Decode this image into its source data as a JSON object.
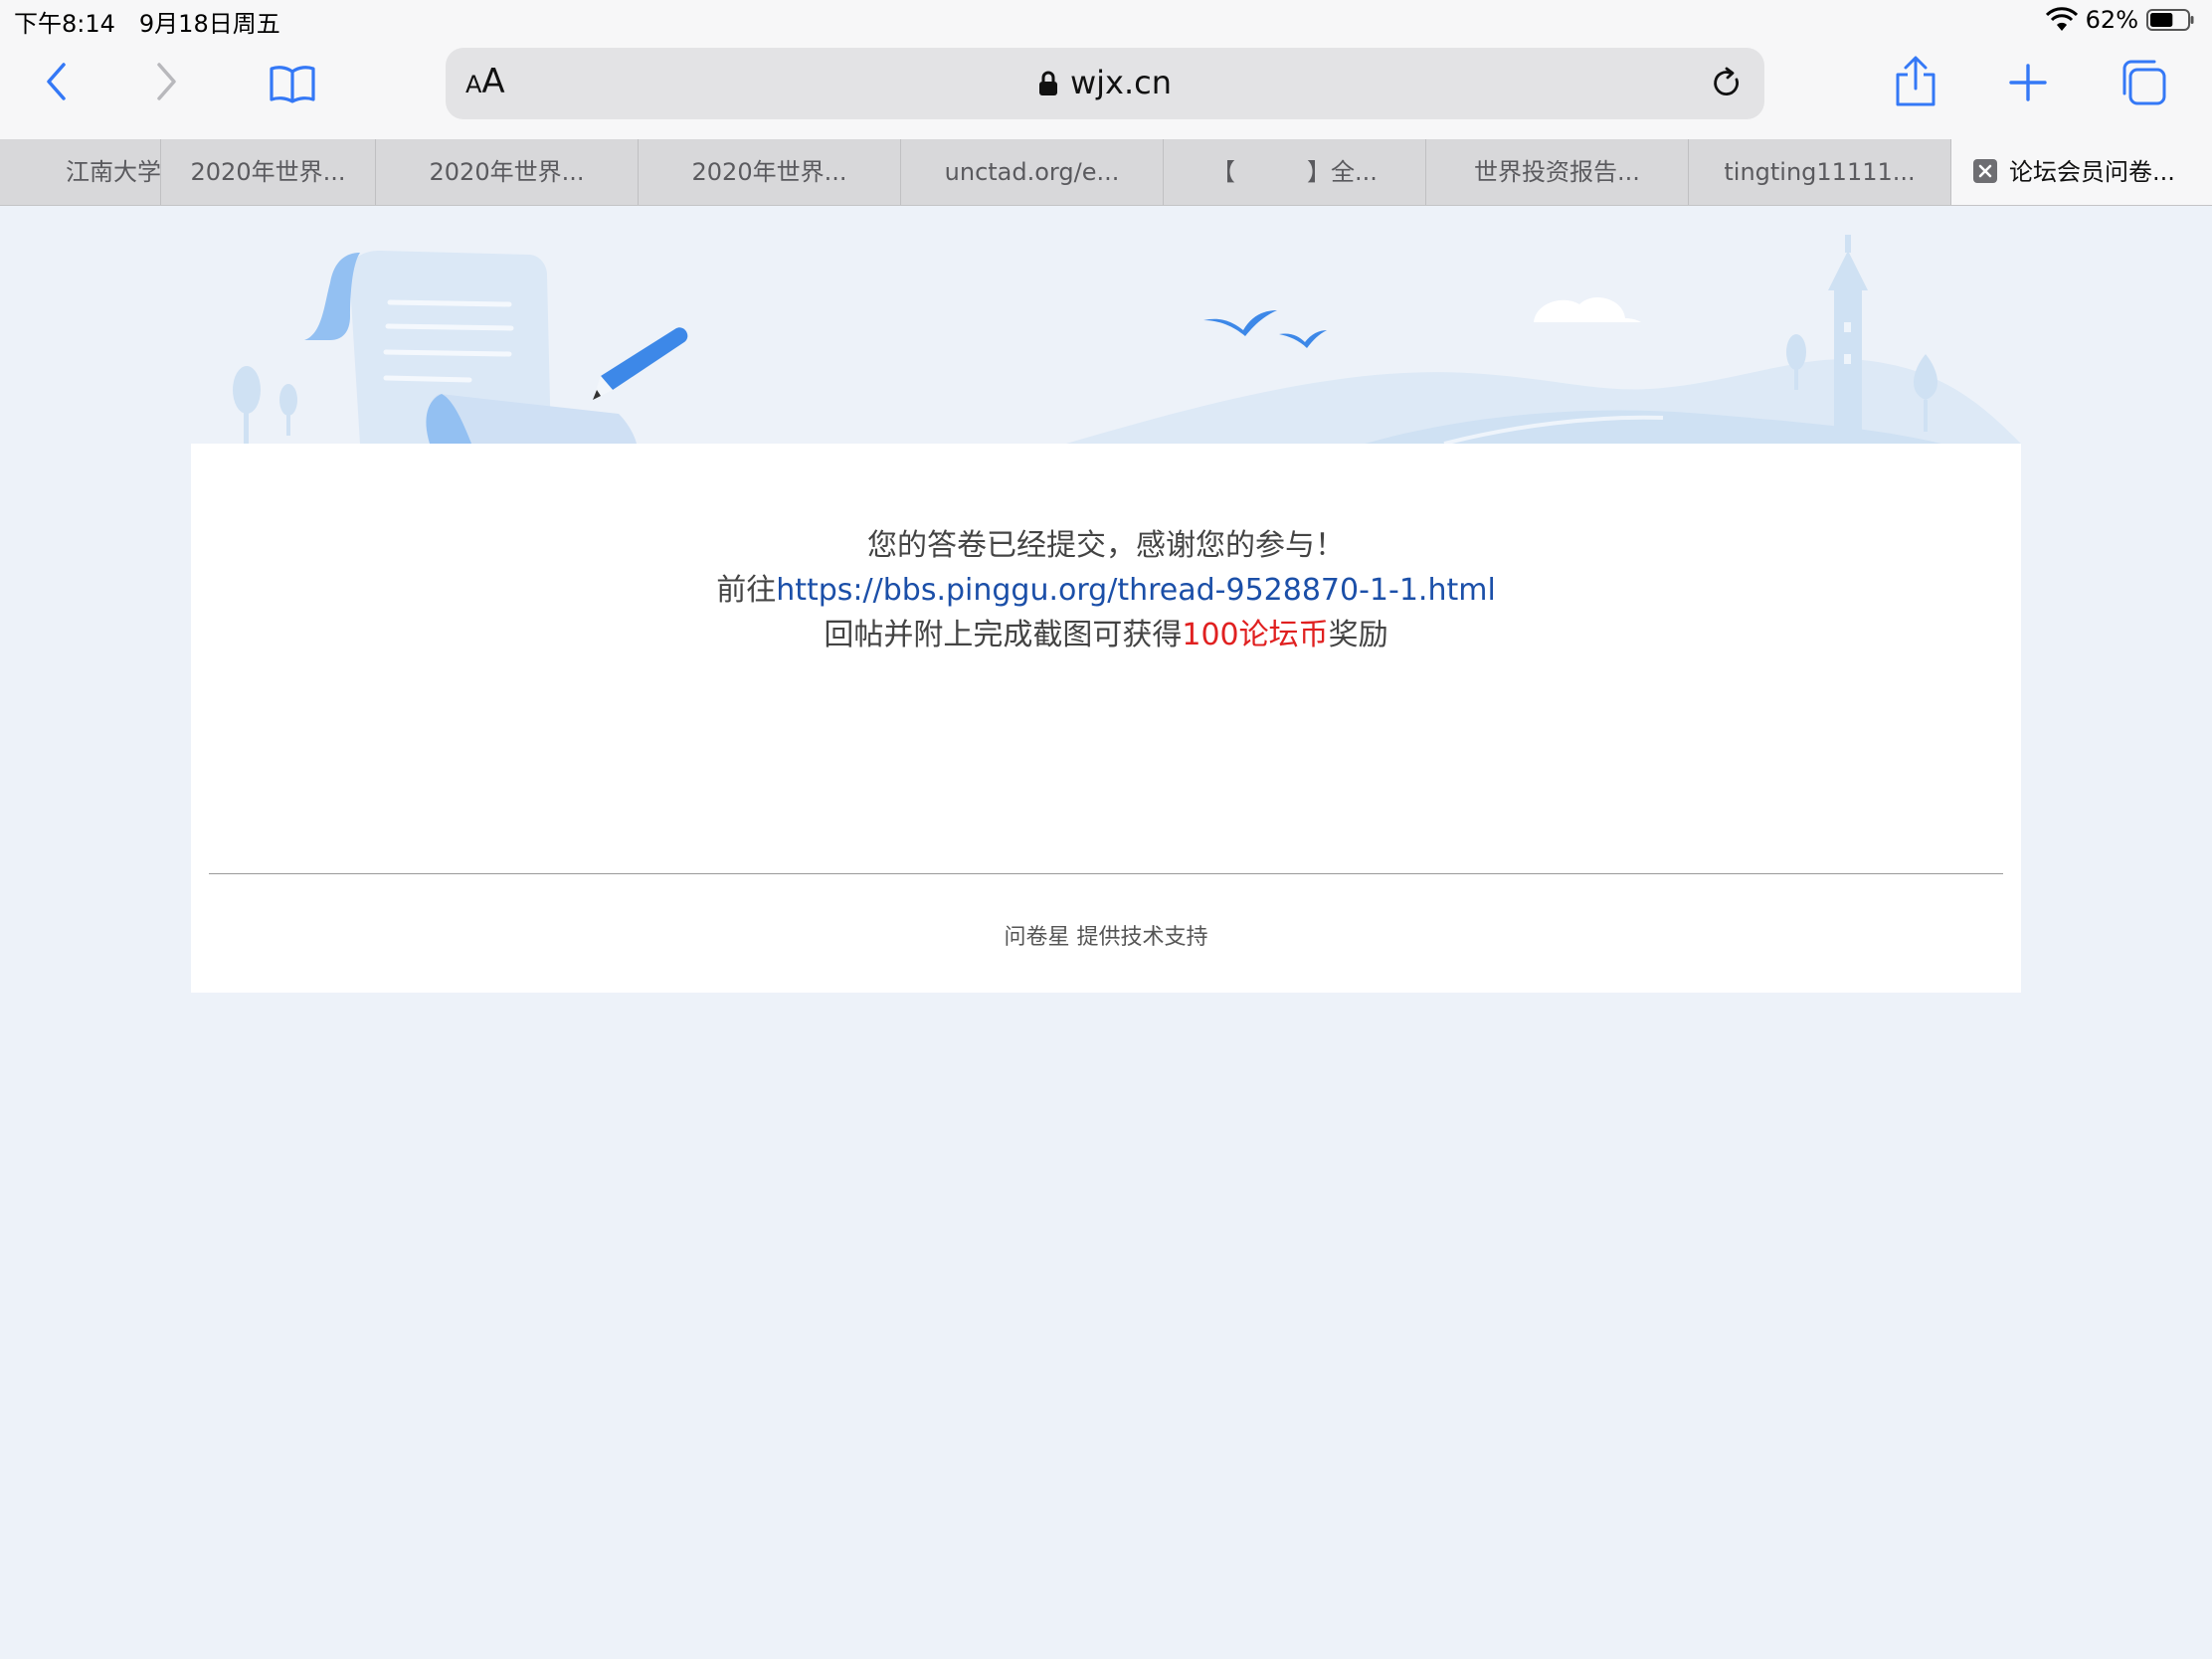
{
  "status_bar": {
    "time": "下午8:14",
    "date": "9月18日周五",
    "battery": "62%",
    "battery_level": 0.62
  },
  "toolbar": {
    "aa_small": "A",
    "aa_large": "A",
    "url": "wjx.cn",
    "icons": [
      "back-icon",
      "forward-icon",
      "bookmarks-icon",
      "lock-icon",
      "reload-icon",
      "share-icon",
      "new-tab-icon",
      "tabs-icon"
    ]
  },
  "tabs": [
    {
      "label": "江南大学"
    },
    {
      "label": "2020年世界..."
    },
    {
      "label": "2020年世界..."
    },
    {
      "label": "2020年世界..."
    },
    {
      "label": "unctad.org/e..."
    },
    {
      "label": "【　　　】全..."
    },
    {
      "label": "世界投资报告..."
    },
    {
      "label": "tingting11111..."
    },
    {
      "label": "论坛会员问卷...",
      "active": true
    }
  ],
  "message": {
    "line1": "您的答卷已经提交，感谢您的参与！",
    "line2_prefix": "前往",
    "line2_link": "https://bbs.pinggu.org/thread-9528870-1-1.html",
    "line3_prefix": "回帖并附上完成截图可获得",
    "line3_highlight": "100论坛币",
    "line3_suffix": "奖励"
  },
  "footer": {
    "text": "问卷星 提供技术支持"
  },
  "colors": {
    "accent": "#3478f6",
    "link": "#1b4fa8",
    "highlight": "#e02020",
    "page_bg": "#edf2f9"
  }
}
